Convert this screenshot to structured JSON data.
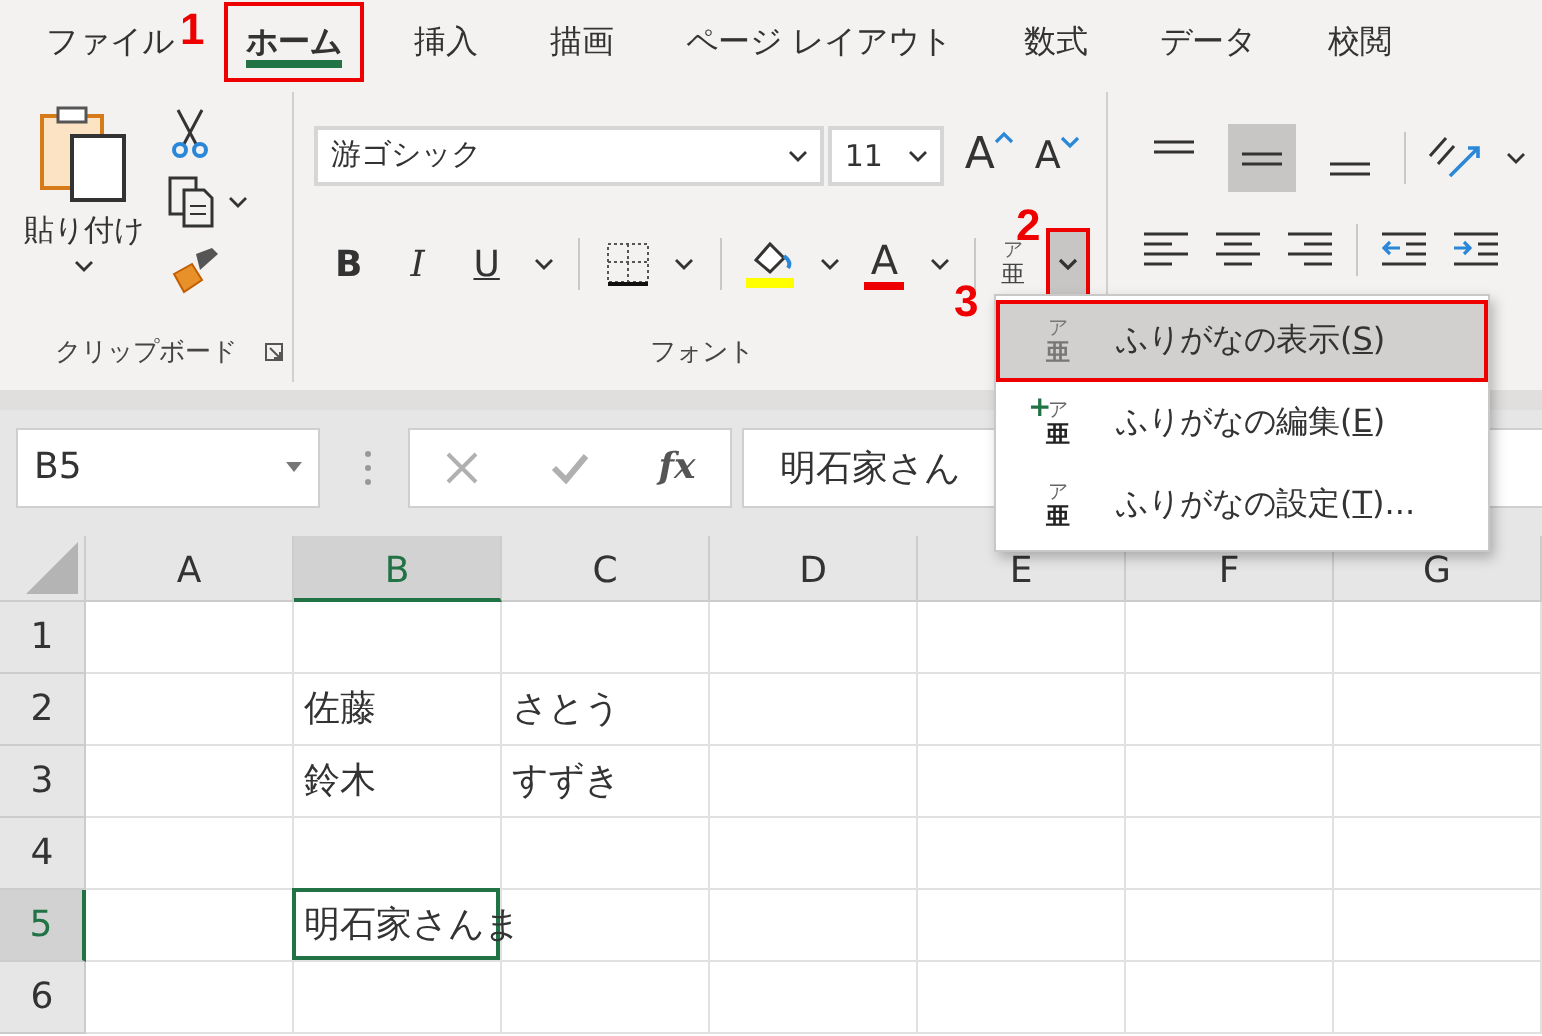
{
  "tabs": [
    {
      "label": "ファイル",
      "selected": false,
      "highlighted": false
    },
    {
      "label": "ホーム",
      "selected": true,
      "highlighted": true
    },
    {
      "label": "挿入",
      "selected": false,
      "highlighted": false
    },
    {
      "label": "描画",
      "selected": false,
      "highlighted": false
    },
    {
      "label": "ページ レイアウト",
      "selected": false,
      "highlighted": false
    },
    {
      "label": "数式",
      "selected": false,
      "highlighted": false
    },
    {
      "label": "データ",
      "selected": false,
      "highlighted": false
    },
    {
      "label": "校閲",
      "selected": false,
      "highlighted": false
    }
  ],
  "ribbon": {
    "clipboard": {
      "paste_label": "貼り付け",
      "group_label": "クリップボード"
    },
    "font": {
      "font_name": "游ゴシック",
      "font_size": "11",
      "grow_label": "A",
      "shrink_label": "A",
      "styles": [
        {
          "kind": "bold",
          "label": "B"
        },
        {
          "kind": "italic",
          "label": "I"
        },
        {
          "kind": "underline",
          "label": "U"
        }
      ],
      "font_color_label": "A",
      "furigana": {
        "ruby": "ア",
        "base": "亜",
        "dropdown_highlighted": true
      },
      "group_label": "フォント"
    },
    "alignment": {
      "vertical": [
        {
          "kind": "top",
          "selected": false
        },
        {
          "kind": "middle",
          "selected": true
        },
        {
          "kind": "bottom",
          "selected": false
        }
      ]
    }
  },
  "formula_bar": {
    "name_box": "B5",
    "fx": "fx",
    "content": "明石家さん"
  },
  "sheet": {
    "columns": [
      {
        "label": "A",
        "selected": false
      },
      {
        "label": "B",
        "selected": true
      },
      {
        "label": "C",
        "selected": false
      },
      {
        "label": "D",
        "selected": false
      },
      {
        "label": "E",
        "selected": false
      },
      {
        "label": "F",
        "selected": false
      },
      {
        "label": "G",
        "selected": false
      }
    ],
    "rows": [
      {
        "header": "1",
        "selected": false
      },
      {
        "header": "2",
        "selected": false,
        "cells": [
          null,
          {
            "text": "佐藤",
            "active": false
          },
          {
            "text": "さとう",
            "active": false
          },
          null,
          null,
          null,
          null
        ]
      },
      {
        "header": "3",
        "selected": false,
        "cells": [
          null,
          {
            "text": "鈴木",
            "active": false
          },
          {
            "text": "すずき",
            "active": false
          },
          null,
          null,
          null,
          null
        ]
      },
      {
        "header": "4",
        "selected": false
      },
      {
        "header": "5",
        "selected": true,
        "cells": [
          null,
          {
            "text": "明石家さんま",
            "active": true
          },
          null,
          null,
          null,
          null,
          null
        ]
      },
      {
        "header": "6",
        "selected": false
      }
    ]
  },
  "menu": {
    "items": [
      {
        "kind": "show",
        "ruby": "ア",
        "base": "亜",
        "before": "ふりがなの表示(",
        "key": "S",
        "after": ")",
        "selected": true,
        "highlighted": true
      },
      {
        "kind": "edit",
        "plus": "+",
        "ruby": "ア",
        "base": "亜",
        "before": "ふりがなの編集(",
        "key": "E",
        "after": ")",
        "selected": false,
        "highlighted": false
      },
      {
        "kind": "settings",
        "ruby": "ア",
        "base": "亜",
        "before": "ふりがなの設定(",
        "key": "T",
        "after": ")...",
        "selected": false,
        "highlighted": false
      }
    ]
  },
  "callouts": [
    {
      "number": "1"
    },
    {
      "number": "2"
    },
    {
      "number": "3"
    }
  ]
}
